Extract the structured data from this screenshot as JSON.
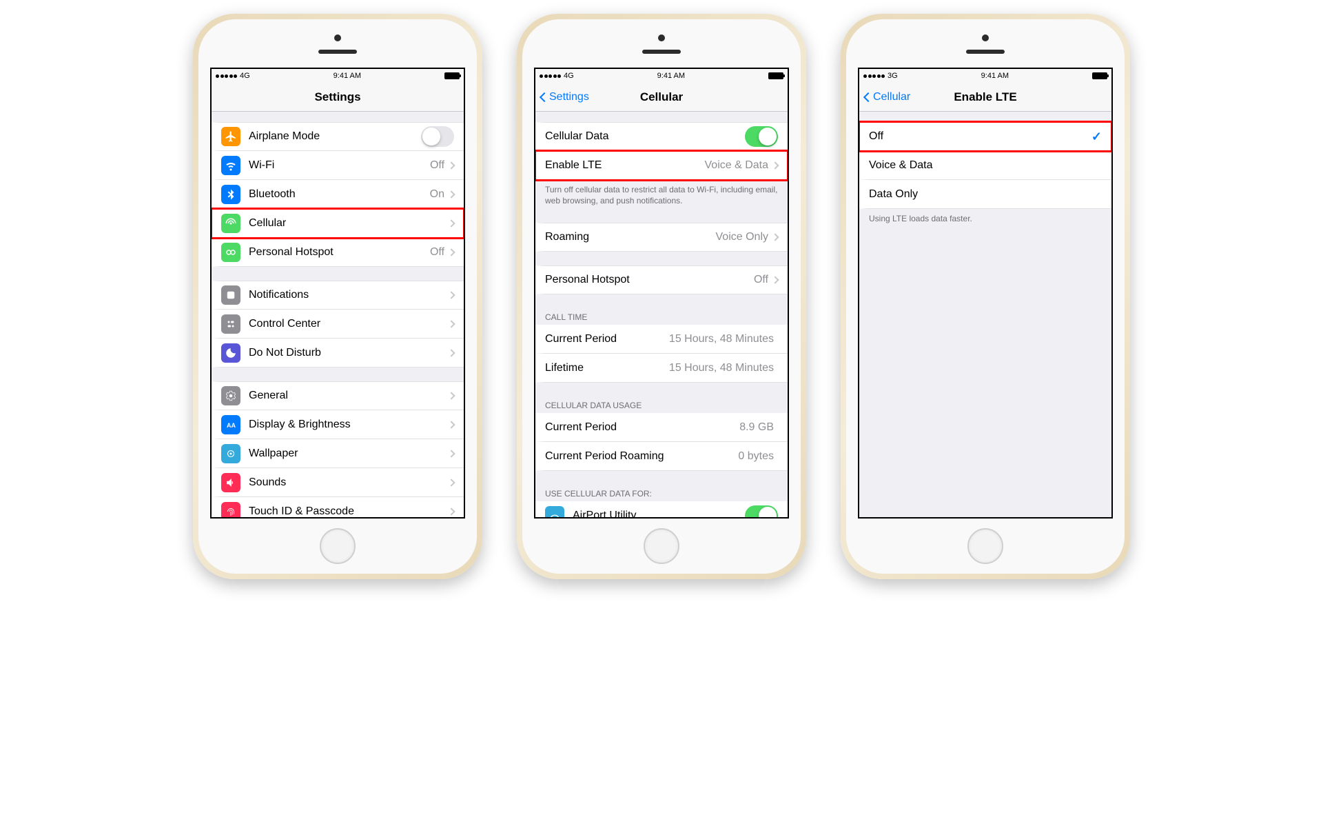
{
  "status": {
    "time": "9:41 AM"
  },
  "carrier": {
    "p1": "4G",
    "p2": "4G",
    "p3": "3G"
  },
  "phone1": {
    "nav_title": "Settings",
    "rows": {
      "airplane": "Airplane Mode",
      "wifi": "Wi-Fi",
      "wifi_val": "Off",
      "bluetooth": "Bluetooth",
      "bluetooth_val": "On",
      "cellular": "Cellular",
      "hotspot": "Personal Hotspot",
      "hotspot_val": "Off",
      "notifications": "Notifications",
      "control_center": "Control Center",
      "dnd": "Do Not Disturb",
      "general": "General",
      "display": "Display & Brightness",
      "wallpaper": "Wallpaper",
      "sounds": "Sounds",
      "touchid": "Touch ID & Passcode"
    }
  },
  "phone2": {
    "nav_back": "Settings",
    "nav_title": "Cellular",
    "rows": {
      "cellular_data": "Cellular Data",
      "enable_lte": "Enable LTE",
      "enable_lte_val": "Voice & Data",
      "footer1": "Turn off cellular data to restrict all data to Wi-Fi, including email, web browsing, and push notifications.",
      "roaming": "Roaming",
      "roaming_val": "Voice Only",
      "hotspot": "Personal Hotspot",
      "hotspot_val": "Off",
      "call_time_header": "CALL TIME",
      "current_period": "Current Period",
      "current_period_val": "15 Hours, 48 Minutes",
      "lifetime": "Lifetime",
      "lifetime_val": "15 Hours, 48 Minutes",
      "data_usage_header": "CELLULAR DATA USAGE",
      "cp2": "Current Period",
      "cp2_val": "8.9 GB",
      "cpr": "Current Period Roaming",
      "cpr_val": "0 bytes",
      "use_for_header": "USE CELLULAR DATA FOR:",
      "airport": "AirPort Utility"
    }
  },
  "phone3": {
    "nav_back": "Cellular",
    "nav_title": "Enable LTE",
    "rows": {
      "off": "Off",
      "voice_data": "Voice & Data",
      "data_only": "Data Only",
      "footer": "Using LTE loads data faster."
    }
  }
}
